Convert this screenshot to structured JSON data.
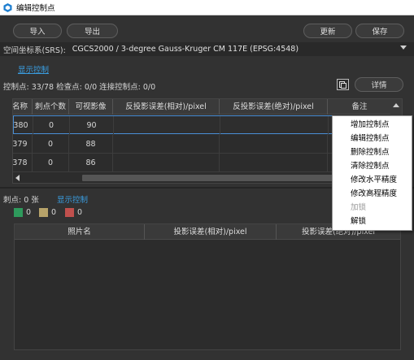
{
  "window": {
    "title": "编辑控制点"
  },
  "toolbar": {
    "import_label": "导入",
    "export_label": "导出",
    "update_label": "更新",
    "save_label": "保存"
  },
  "srs": {
    "label": "空间坐标系(SRS):",
    "value": "CGCS2000 / 3-degree Gauss-Kruger CM 117E (EPSG:4548)"
  },
  "display_control_link": "显示控制",
  "stats": {
    "text": "控制点: 33/78 检查点: 0/0 连接控制点: 0/0",
    "detail_label": "详情"
  },
  "table1": {
    "headers": [
      "名称",
      "刺点个数",
      "可视影像",
      "反投影误差(相对)/pixel",
      "反投影误差(绝对)/pixel",
      "备注"
    ],
    "rows": [
      [
        "380",
        "0",
        "90",
        "",
        "",
        ""
      ],
      [
        "379",
        "0",
        "88",
        "",
        "",
        ""
      ],
      [
        "378",
        "0",
        "86",
        "",
        "",
        ""
      ]
    ]
  },
  "section2": {
    "prefix": "刺点: 0 张",
    "link": "显示控制"
  },
  "legend": [
    {
      "color": "#2e9a5c",
      "count": "0"
    },
    {
      "color": "#b7a36a",
      "count": "0"
    },
    {
      "color": "#c0504d",
      "count": "0"
    }
  ],
  "table2": {
    "headers": [
      "照片名",
      "投影误差(相对)/pixel",
      "投影误差(绝对)/pixel"
    ]
  },
  "context_menu": {
    "items": [
      {
        "label": "增加控制点",
        "enabled": true
      },
      {
        "label": "编辑控制点",
        "enabled": true
      },
      {
        "label": "删除控制点",
        "enabled": true
      },
      {
        "label": "清除控制点",
        "enabled": true
      },
      {
        "label": "修改水平精度",
        "enabled": true
      },
      {
        "label": "修改高程精度",
        "enabled": true
      },
      {
        "label": "加锁",
        "enabled": false
      },
      {
        "label": "解锁",
        "enabled": true
      }
    ]
  }
}
